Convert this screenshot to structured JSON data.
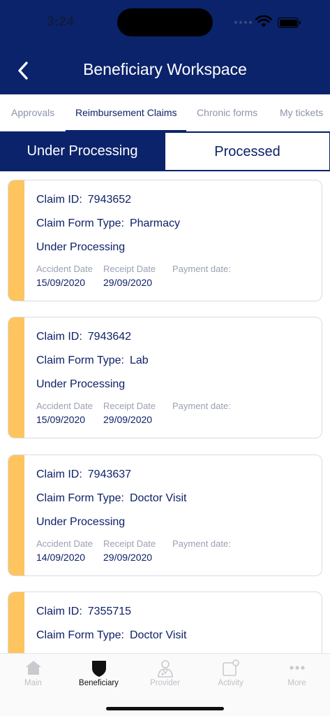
{
  "status_bar": {
    "time": "3:24"
  },
  "header": {
    "title": "Beneficiary Workspace",
    "back_icon": "chevron-left-icon"
  },
  "tabs": [
    {
      "label": "Approvals",
      "active": false
    },
    {
      "label": "Reimbursement Claims",
      "active": true
    },
    {
      "label": "Chronic forms",
      "active": false
    },
    {
      "label": "My tickets",
      "active": false
    }
  ],
  "segments": {
    "left": "Under Processing",
    "right": "Processed",
    "selected": "Under Processing"
  },
  "card_labels": {
    "claim_id": "Claim ID:",
    "form_type": "Claim Form Type:",
    "accident_date": "Accident Date",
    "receipt_date": "Receipt Date",
    "payment_date": "Payment date:"
  },
  "claims": [
    {
      "id": "7943652",
      "form_type": "Pharmacy",
      "status": "Under Processing",
      "accident_date": "15/09/2020",
      "receipt_date": "29/09/2020",
      "payment_date": ""
    },
    {
      "id": "7943642",
      "form_type": "Lab",
      "status": "Under Processing",
      "accident_date": "15/09/2020",
      "receipt_date": "29/09/2020",
      "payment_date": ""
    },
    {
      "id": "7943637",
      "form_type": "Doctor Visit",
      "status": "Under Processing",
      "accident_date": "14/09/2020",
      "receipt_date": "29/09/2020",
      "payment_date": ""
    },
    {
      "id": "7355715",
      "form_type": "Doctor Visit",
      "status": "",
      "accident_date": "",
      "receipt_date": "",
      "payment_date": ""
    }
  ],
  "colors": {
    "primary": "#0b236b",
    "accent": "#fec45e",
    "muted": "#9aa0b3"
  },
  "tab_bar": [
    {
      "label": "Main",
      "icon": "home-icon",
      "active": false
    },
    {
      "label": "Beneficiary",
      "icon": "shield-icon",
      "active": true
    },
    {
      "label": "Provider",
      "icon": "doctor-icon",
      "active": false
    },
    {
      "label": "Activity",
      "icon": "notification-icon",
      "active": false
    },
    {
      "label": "More",
      "icon": "more-icon",
      "active": false
    }
  ]
}
